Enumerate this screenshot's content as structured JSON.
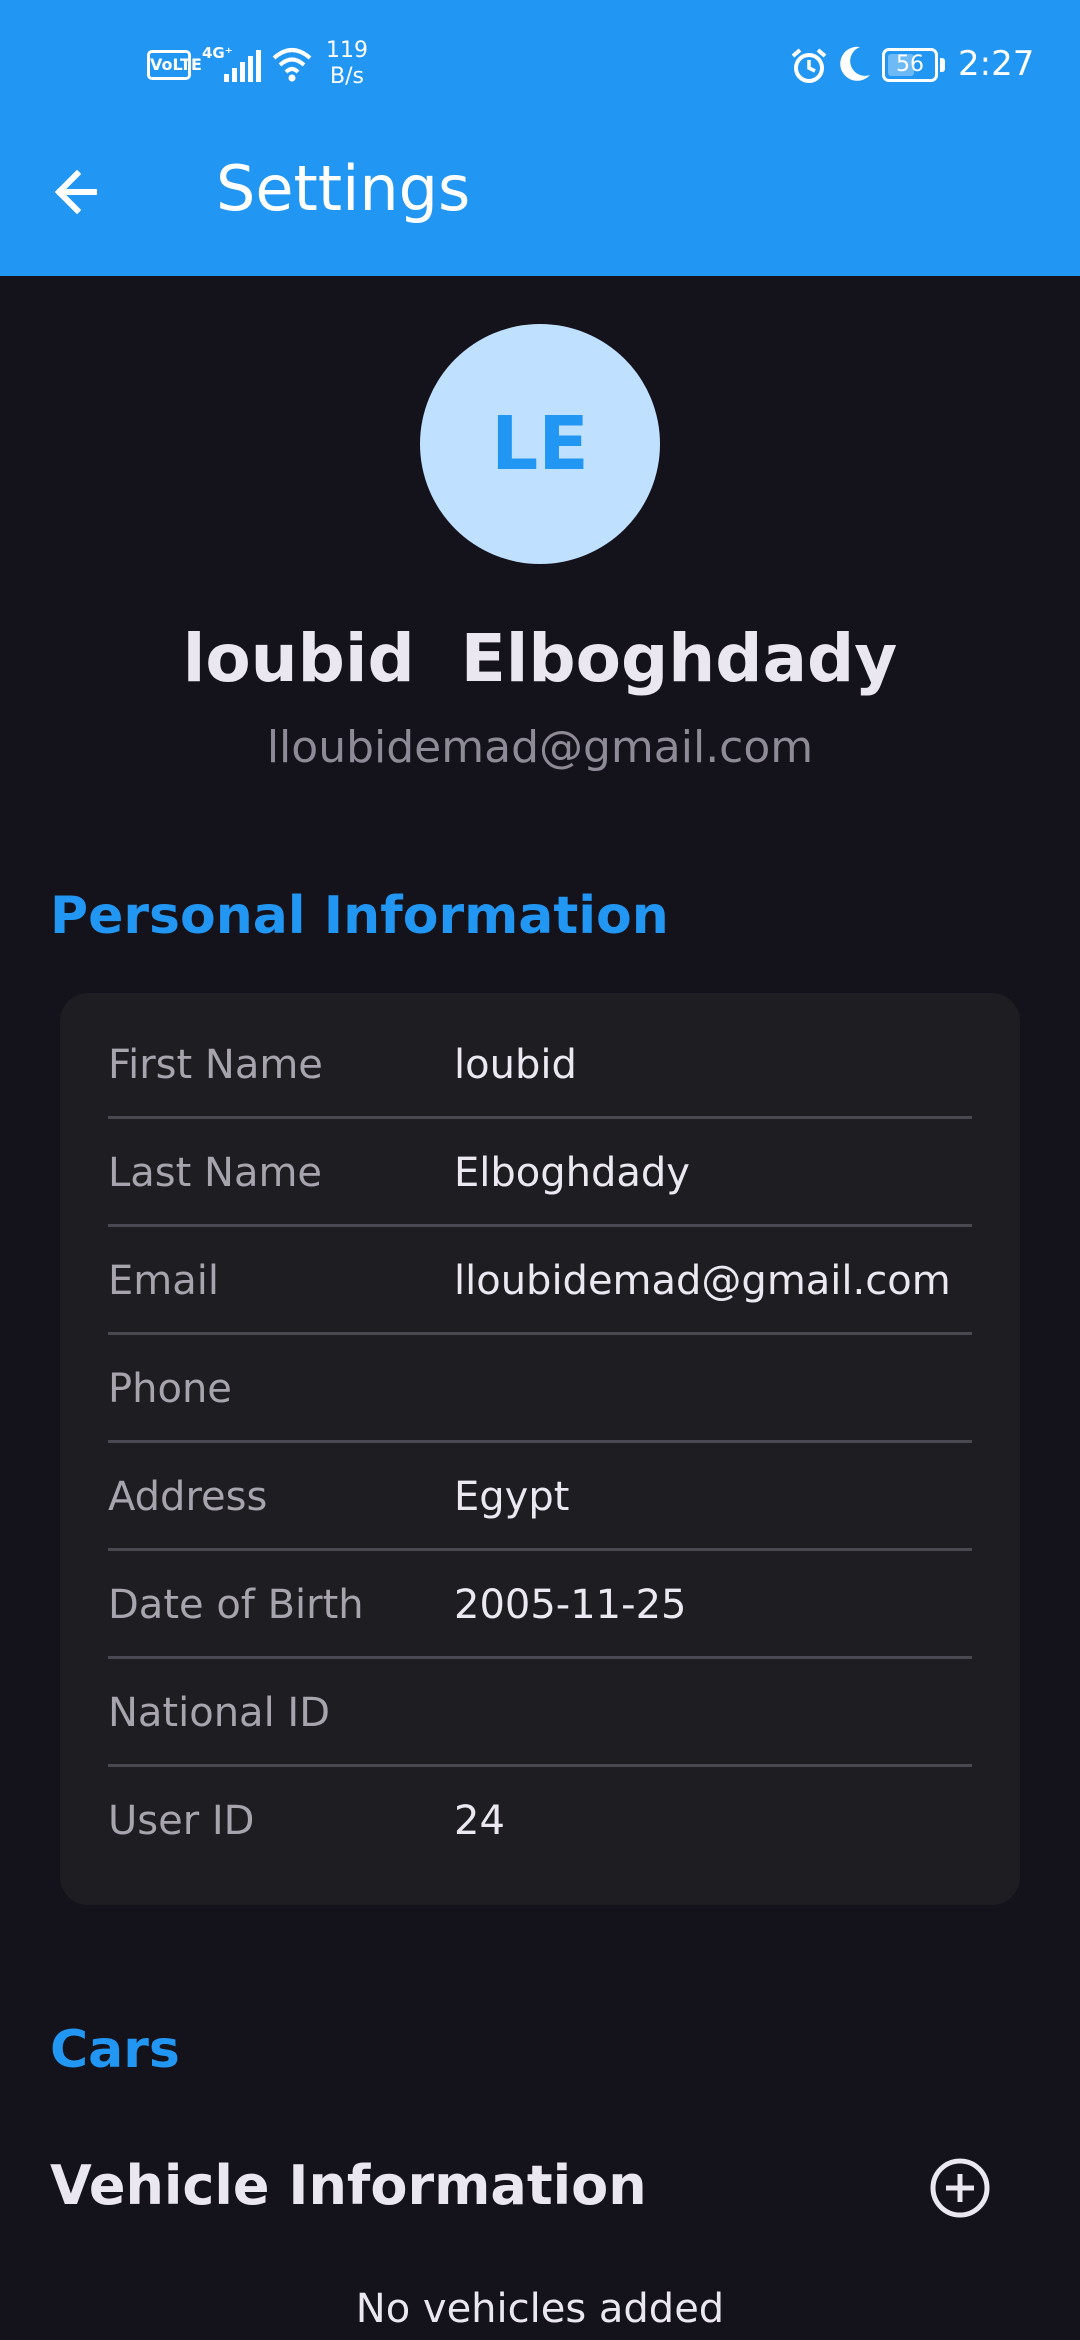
{
  "status_bar": {
    "volte": "VoLTE",
    "network": "4G⁺",
    "speed_value": "119",
    "speed_unit": "B/s",
    "battery": "56",
    "time": "2:27"
  },
  "header": {
    "title": "Settings"
  },
  "profile": {
    "initials": "LE",
    "full_name": "loubid  Elboghdady",
    "email": "lloubidemad@gmail.com"
  },
  "personal_info": {
    "section_title": "Personal Information",
    "rows": [
      {
        "label": "First Name",
        "value": "loubid"
      },
      {
        "label": "Last Name",
        "value": "Elboghdady"
      },
      {
        "label": "Email",
        "value": "lloubidemad@gmail.com"
      },
      {
        "label": "Phone",
        "value": ""
      },
      {
        "label": "Address",
        "value": "Egypt"
      },
      {
        "label": "Date of Birth",
        "value": "2005-11-25"
      },
      {
        "label": "National ID",
        "value": ""
      },
      {
        "label": "User ID",
        "value": "24"
      }
    ]
  },
  "cars": {
    "section_title": "Cars",
    "vehicle_title": "Vehicle Information",
    "empty_text": "No vehicles added"
  },
  "colors": {
    "accent": "#2196f3",
    "background": "#14121a",
    "card": "#1e1d22",
    "avatar_bg": "#bfe0ff"
  },
  "icons": {
    "back": "arrow-left-icon",
    "add": "add-circle-icon"
  }
}
